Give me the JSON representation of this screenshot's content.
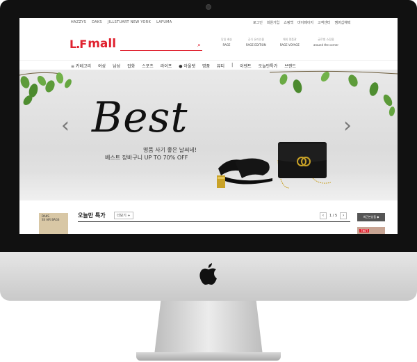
{
  "topbar": {
    "brands": [
      "HAZZYS",
      "DAKS",
      "JILLSTUART NEW YORK",
      "LAFUMA"
    ],
    "util_links": [
      "로그인",
      "회원가입",
      "쇼핑백",
      "마이페이지",
      "고객센터",
      "멤버십혜택"
    ]
  },
  "header": {
    "logo_mark": "L.F",
    "logo_word": "mall",
    "search_placeholder": "",
    "promos": [
      {
        "top": "당일 배송",
        "bottom": "RAGE"
      },
      {
        "top": "공식 온라인몰",
        "bottom": "RAGE EDITION"
      },
      {
        "top": "해외 명품관",
        "bottom": "RAGE VOYAGE"
      },
      {
        "top": "글로벌 쇼핑몰",
        "bottom": "around the corner"
      }
    ]
  },
  "nav": {
    "items": [
      "≡ 카테고리",
      "여성",
      "남성",
      "잡화",
      "스포츠",
      "라이프",
      "● 아울렛",
      "명품",
      "뷰티",
      "|",
      "이벤트",
      "오늘만특가",
      "브랜드"
    ]
  },
  "hero": {
    "headline": "Best",
    "line1": "명품 사기 좋은 날씨네!",
    "line2": "베스트 장바구니 UP TO 70% OFF",
    "prev": "‹",
    "next": "›"
  },
  "deal": {
    "title": "오늘만 특가",
    "more": "더보기 +",
    "page": "1 / 5",
    "prev": "‹",
    "next": "›",
    "thumb_caption": [
      "DAKS",
      "SS AIR BAGS"
    ],
    "side_button": "최근본상품 ◆",
    "side_tag": "TNET"
  },
  "colors": {
    "brand": "#e0212e",
    "bezel": "#111111",
    "hero_bg": "#e6e6e6"
  },
  "icons": {
    "search": "search-icon",
    "apple": "apple-logo-icon"
  }
}
